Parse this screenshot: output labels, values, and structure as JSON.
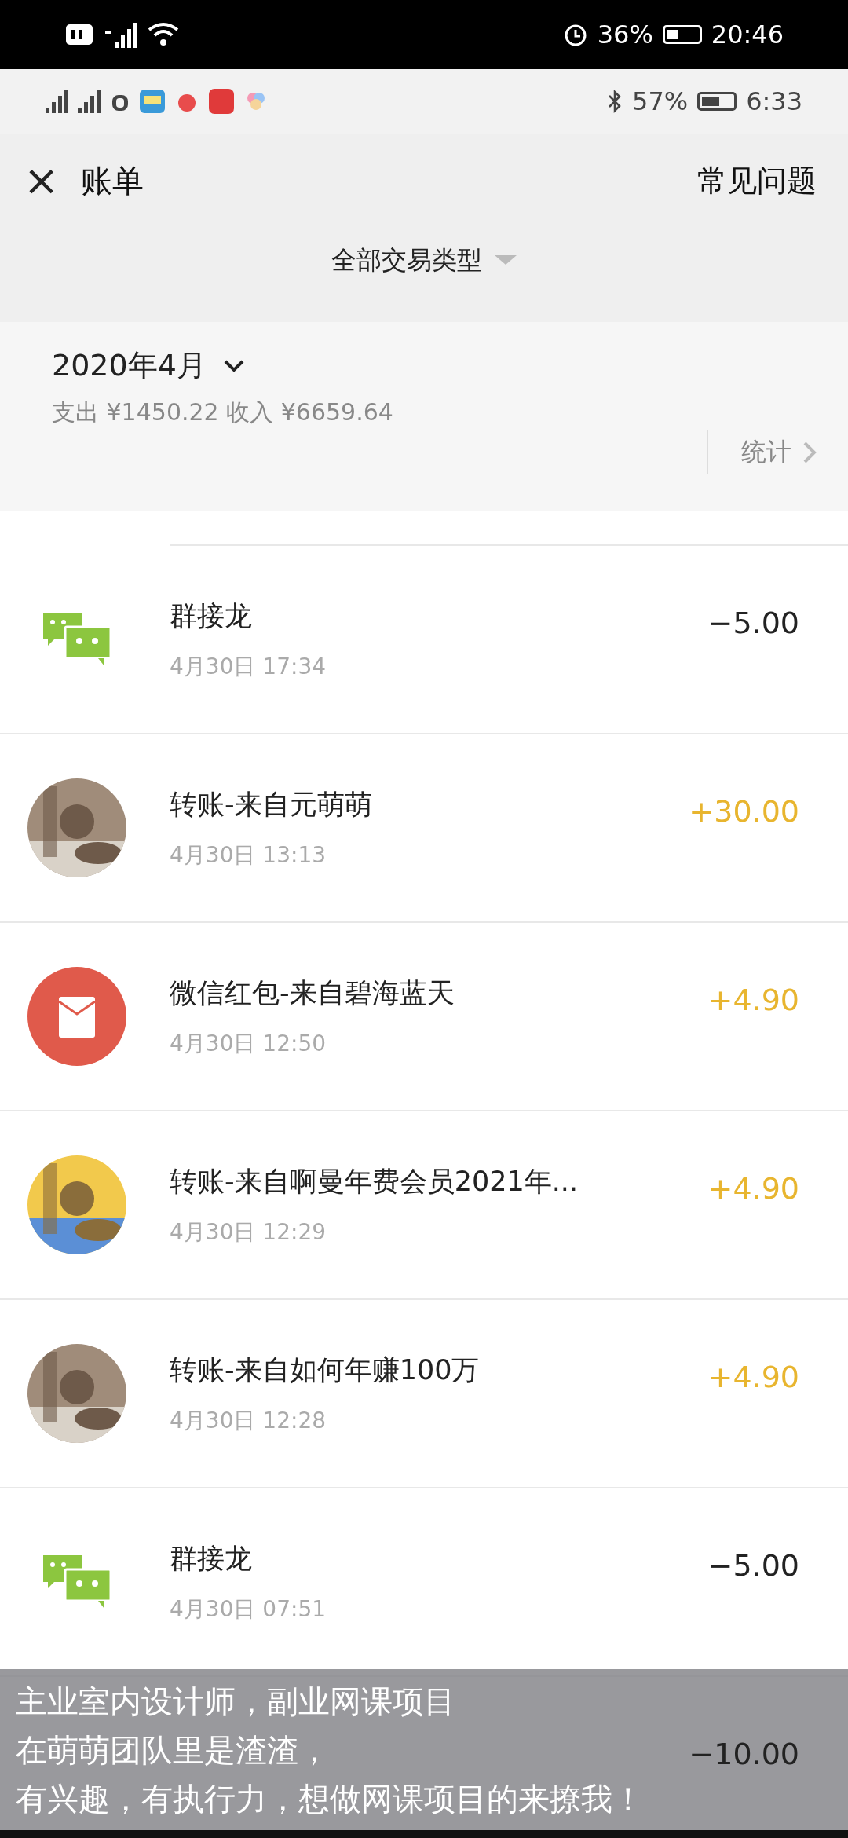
{
  "outer_status_bar": {
    "battery_percent": "36%",
    "time": "20:46"
  },
  "inner_status_bar": {
    "battery_percent": "57%",
    "time": "6:33"
  },
  "header": {
    "title": "账单",
    "close_icon": "×",
    "help": "常见问题"
  },
  "filter": {
    "label": "全部交易类型"
  },
  "summary": {
    "month": "2020年4月",
    "totals": "支出 ¥1450.22 收入 ¥6659.64",
    "stats": "统计"
  },
  "transactions": [
    {
      "kind": "group",
      "title": "群接龙",
      "time": "4月30日 17:34",
      "amount": "−5.00",
      "income": false
    },
    {
      "kind": "picture",
      "title": "转账-来自元萌萌",
      "time": "4月30日 13:13",
      "amount": "+30.00",
      "income": true
    },
    {
      "kind": "envelope",
      "title": "微信红包-来自碧海蓝天",
      "time": "4月30日 12:50",
      "amount": "+4.90",
      "income": true
    },
    {
      "kind": "picture",
      "title": "转账-来自啊曼年费会员2021年...",
      "time": "4月30日 12:29",
      "amount": "+4.90",
      "income": true
    },
    {
      "kind": "picture",
      "title": "转账-来自如何年赚100万",
      "time": "4月30日 12:28",
      "amount": "+4.90",
      "income": true
    },
    {
      "kind": "group",
      "title": "群接龙",
      "time": "4月30日 07:51",
      "amount": "−5.00",
      "income": false
    },
    {
      "amount": "−10.00",
      "income": false
    }
  ],
  "caption": {
    "lines": [
      "主业室内设计师，副业网课项目",
      "在萌萌团队里是渣渣，",
      "有兴趣，有执行力，想做网课项目的来撩我！"
    ]
  }
}
